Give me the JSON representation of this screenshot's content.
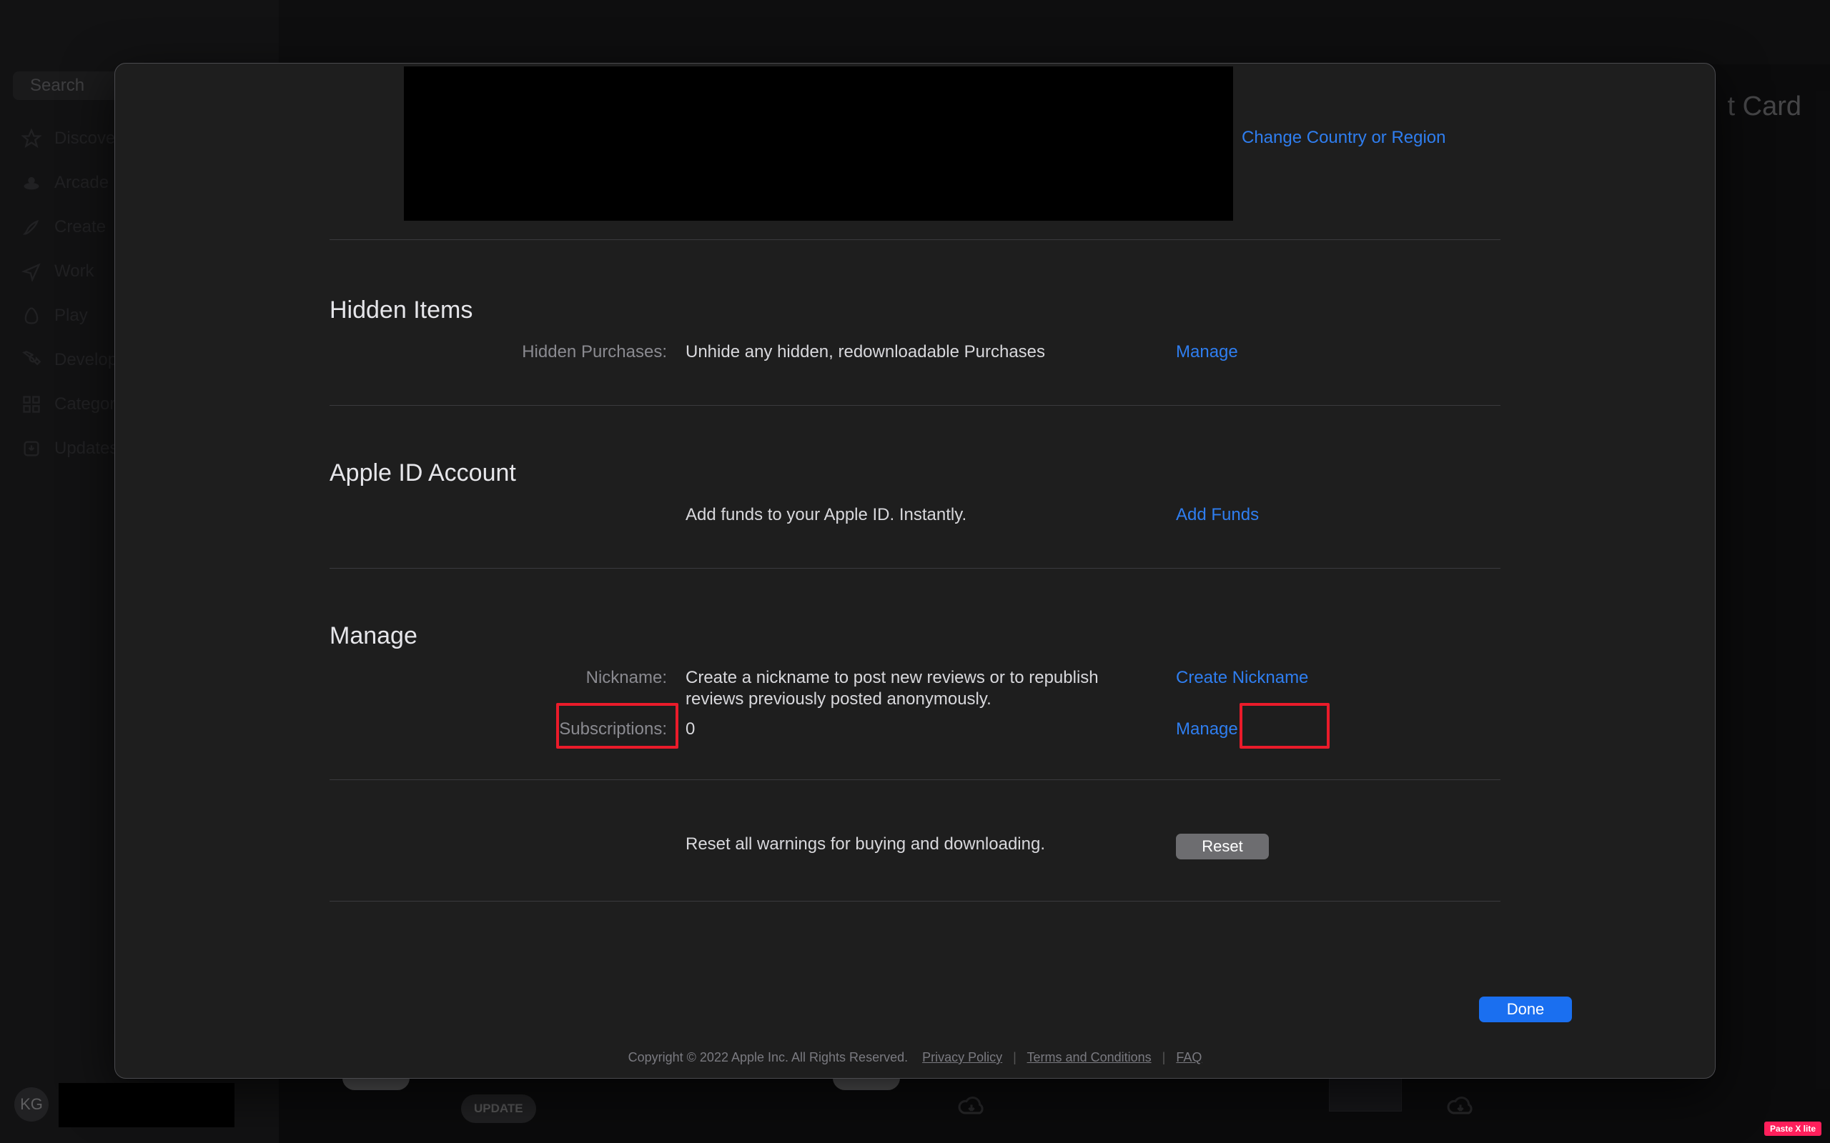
{
  "search": {
    "placeholder": "Search"
  },
  "sidebar": {
    "items": [
      {
        "label": "Discover"
      },
      {
        "label": "Arcade"
      },
      {
        "label": "Create"
      },
      {
        "label": "Work"
      },
      {
        "label": "Play"
      },
      {
        "label": "Develop"
      },
      {
        "label": "Categories"
      },
      {
        "label": "Updates"
      }
    ]
  },
  "avatar": "KG",
  "header_right": "t Card",
  "bottom": {
    "update": "UPDATE"
  },
  "modal": {
    "change_region": "Change Country or Region",
    "hidden": {
      "title": "Hidden Items",
      "row": {
        "label": "Hidden Purchases:",
        "value": "Unhide any hidden, redownloadable Purchases",
        "action": "Manage"
      }
    },
    "appleid": {
      "title": "Apple ID Account",
      "row": {
        "label": "",
        "value": "Add funds to your Apple ID. Instantly.",
        "action": "Add Funds"
      }
    },
    "manage": {
      "title": "Manage",
      "nick": {
        "label": "Nickname:",
        "value": "Create a nickname to post new reviews or to republish reviews previously posted anonymously.",
        "action": "Create Nickname"
      },
      "subs": {
        "label": "Subscriptions:",
        "value": "0",
        "action": "Manage"
      }
    },
    "reset_text": "Reset all warnings for buying and downloading.",
    "reset_btn": "Reset",
    "done": "Done",
    "footer": {
      "copyright": "Copyright © 2022 Apple Inc. All Rights Reserved.",
      "privacy": "Privacy Policy",
      "terms": "Terms and Conditions",
      "faq": "FAQ"
    }
  },
  "badge": "Paste X lite"
}
